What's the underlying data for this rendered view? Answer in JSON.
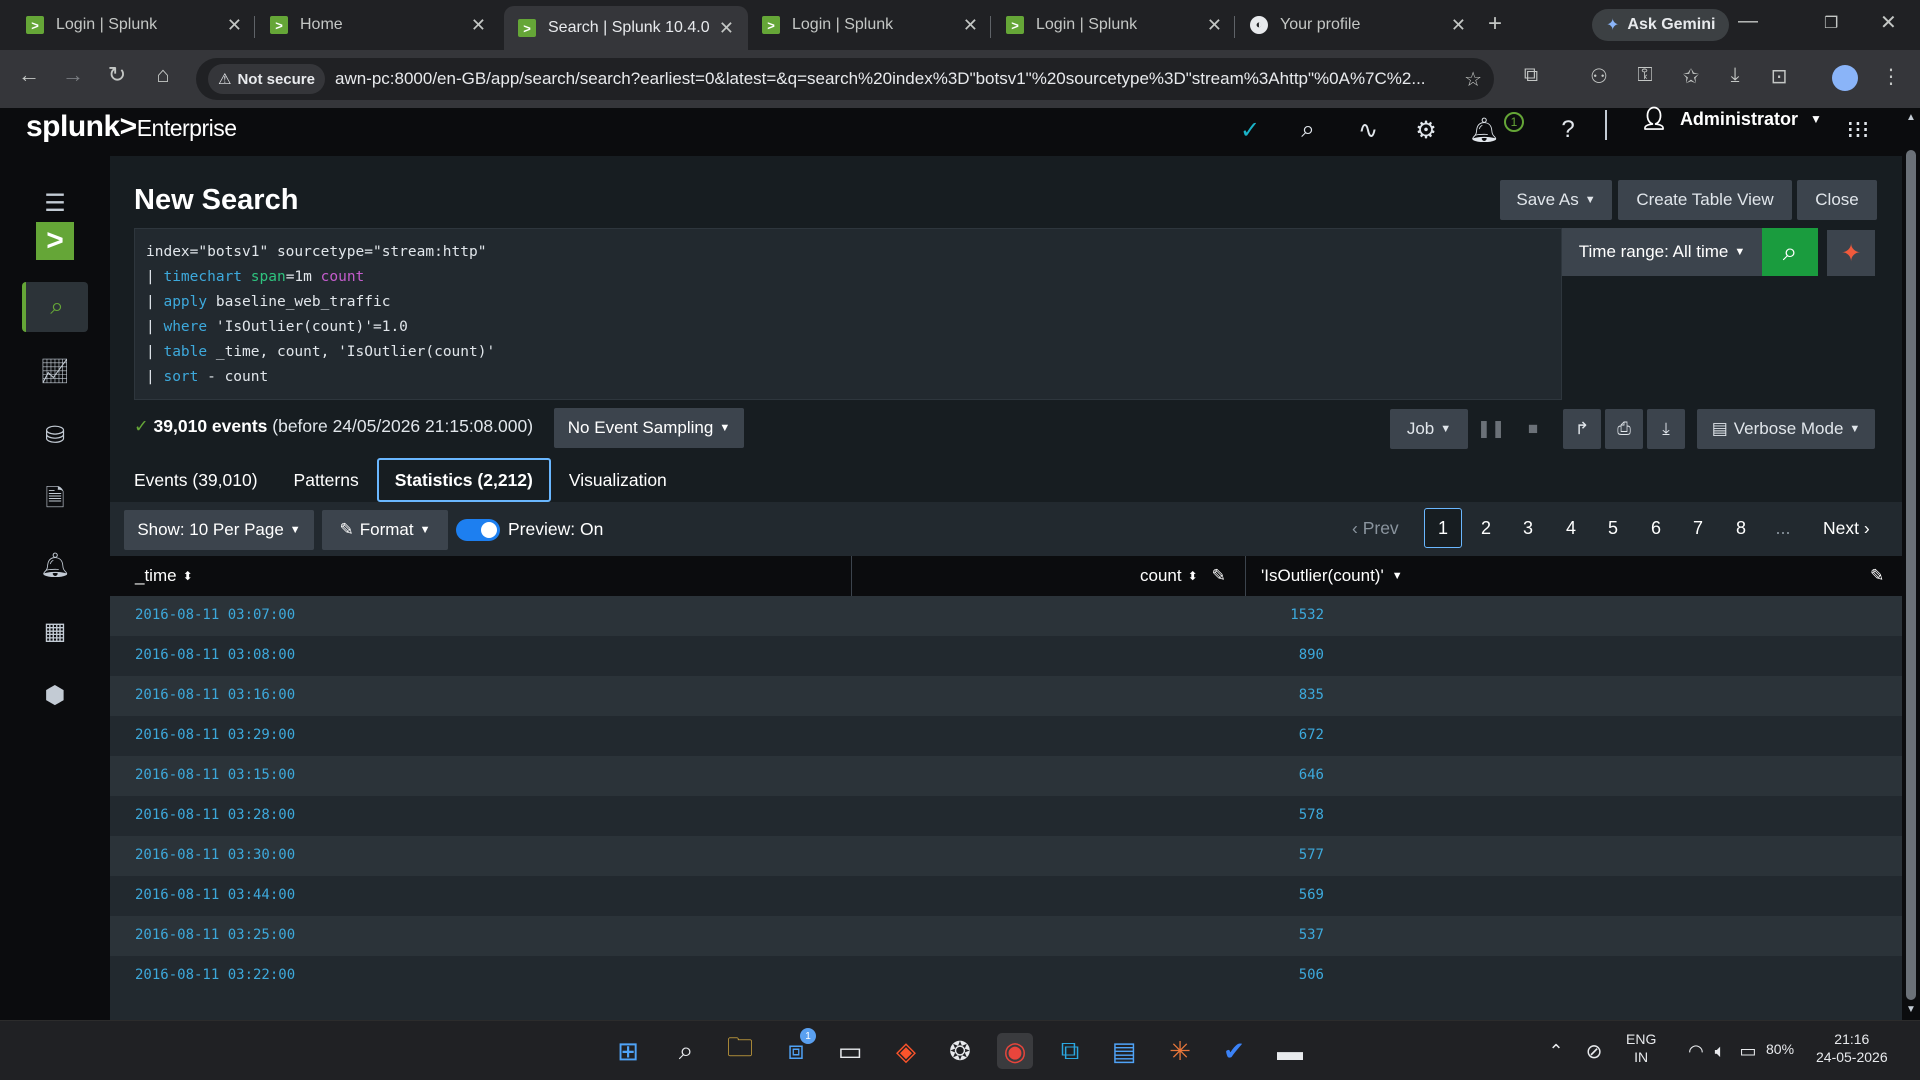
{
  "browser": {
    "tabs": [
      {
        "title": "Login | Splunk",
        "icon": "splunk-favicon"
      },
      {
        "title": "Home",
        "icon": "splunk-favicon"
      },
      {
        "title": "Search | Splunk 10.4.0",
        "icon": "splunk-favicon",
        "active": true
      },
      {
        "title": "Login | Splunk",
        "icon": "splunk-favicon"
      },
      {
        "title": "Login | Splunk",
        "icon": "splunk-favicon"
      },
      {
        "title": "Your profile",
        "icon": "github-favicon"
      }
    ],
    "gemini_label": "Ask Gemini",
    "not_secure_label": "Not secure",
    "url": "awn-pc:8000/en-GB/app/search/search?earliest=0&latest=&q=search%20index%3D\"botsv1\"%20sourcetype%3D\"stream%3Ahttp\"%0A%7C%2..."
  },
  "splunk": {
    "logo": "splunk>",
    "logo_suffix": "Enterprise",
    "notification_count": "1",
    "user": "Administrator"
  },
  "page": {
    "title": "New Search",
    "save_as": "Save As",
    "create_table_view": "Create Table View",
    "close": "Close",
    "time_range": "Time range: All time",
    "query_lines": [
      {
        "parts": [
          {
            "t": "index=\"botsv1\" sourcetype=\"stream:http\"",
            "c": ""
          }
        ]
      },
      {
        "parts": [
          {
            "t": "| ",
            "c": ""
          },
          {
            "t": "timechart",
            "c": "kw"
          },
          {
            "t": " ",
            "c": ""
          },
          {
            "t": "span",
            "c": "arg"
          },
          {
            "t": "=1m ",
            "c": ""
          },
          {
            "t": "count",
            "c": "fn"
          }
        ]
      },
      {
        "parts": [
          {
            "t": "| ",
            "c": ""
          },
          {
            "t": "apply",
            "c": "kw"
          },
          {
            "t": " baseline_web_traffic",
            "c": ""
          }
        ]
      },
      {
        "parts": [
          {
            "t": "| ",
            "c": ""
          },
          {
            "t": "where",
            "c": "kw"
          },
          {
            "t": " 'IsOutlier(count)'=1.0",
            "c": ""
          }
        ]
      },
      {
        "parts": [
          {
            "t": "| ",
            "c": ""
          },
          {
            "t": "table",
            "c": "kw"
          },
          {
            "t": " _time, count, 'IsOutlier(count)'",
            "c": ""
          }
        ]
      },
      {
        "parts": [
          {
            "t": "| ",
            "c": ""
          },
          {
            "t": "sort",
            "c": "kw"
          },
          {
            "t": " - count",
            "c": ""
          }
        ]
      }
    ],
    "events_count": "39,010 events",
    "events_before": "(before 24/05/2026 21:15:08.000)",
    "sampling": "No Event Sampling",
    "job": "Job",
    "mode": "Verbose Mode",
    "tabs": [
      "Events (39,010)",
      "Patterns",
      "Statistics (2,212)",
      "Visualization"
    ],
    "show_per_page": "Show: 10 Per Page",
    "format": "Format",
    "preview": "Preview: On",
    "pager": {
      "prev": "Prev",
      "next": "Next",
      "pages": [
        "1",
        "2",
        "3",
        "4",
        "5",
        "6",
        "7",
        "8"
      ],
      "ellipsis": "...",
      "current": "1"
    }
  },
  "table": {
    "columns": [
      "_time",
      "count",
      "'IsOutlier(count)'"
    ],
    "rows": [
      {
        "time": "2016-08-11 03:07:00",
        "count": "1532",
        "outlier": ""
      },
      {
        "time": "2016-08-11 03:08:00",
        "count": "890",
        "outlier": ""
      },
      {
        "time": "2016-08-11 03:16:00",
        "count": "835",
        "outlier": ""
      },
      {
        "time": "2016-08-11 03:29:00",
        "count": "672",
        "outlier": ""
      },
      {
        "time": "2016-08-11 03:15:00",
        "count": "646",
        "outlier": ""
      },
      {
        "time": "2016-08-11 03:28:00",
        "count": "578",
        "outlier": ""
      },
      {
        "time": "2016-08-11 03:30:00",
        "count": "577",
        "outlier": ""
      },
      {
        "time": "2016-08-11 03:44:00",
        "count": "569",
        "outlier": ""
      },
      {
        "time": "2016-08-11 03:25:00",
        "count": "537",
        "outlier": ""
      },
      {
        "time": "2016-08-11 03:22:00",
        "count": "506",
        "outlier": ""
      }
    ]
  },
  "taskbar": {
    "lang": "ENG",
    "region": "IN",
    "battery": "80%",
    "time": "21:16",
    "date": "24-05-2026",
    "store_badge": "1"
  },
  "colors": {
    "splunk_green": "#65a637",
    "link_blue": "#3da9dc",
    "search_green": "#1a9c3e"
  }
}
